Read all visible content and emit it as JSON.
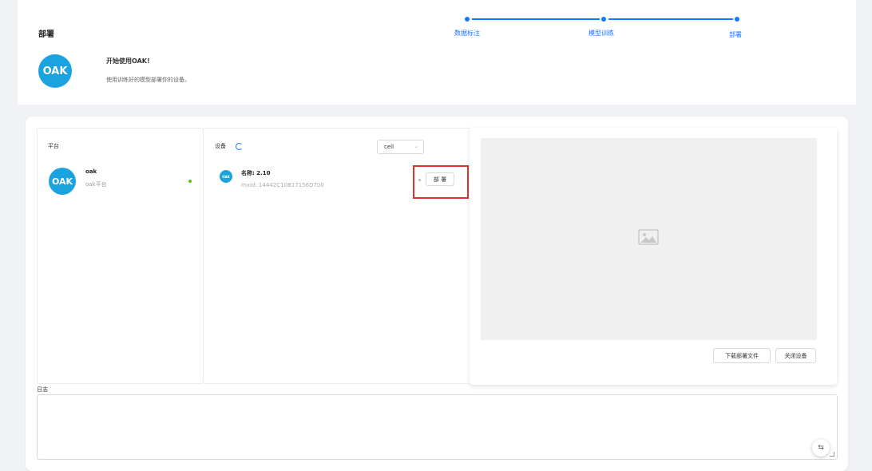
{
  "header": {
    "title": "部署",
    "logo_text": "OAK",
    "intro_title": "开始使用OAK!",
    "intro_desc": "使用训练好的模型部署你的设备。"
  },
  "steps": [
    {
      "label": "数据标注"
    },
    {
      "label": "模型训练"
    },
    {
      "label": "部署"
    }
  ],
  "accent_color": "#1677ff",
  "platform": {
    "title": "平台",
    "logo_text": "OAK",
    "name": "oak",
    "sub": "oak平台",
    "status_color": "#52c41a"
  },
  "device": {
    "title": "设备",
    "select_value": "cell",
    "logo_text": "OAK",
    "name": "名称: 2.10",
    "mxid": "mxid: 14442C10B17156D700",
    "deploy_label": "部 署"
  },
  "preview": {
    "download_label": "下载部署文件",
    "close_label": "关闭设备"
  },
  "log": {
    "label": "日志"
  },
  "icons": {
    "spinner": "loading-icon",
    "image": "image-placeholder-icon",
    "swap": "swap-icon"
  }
}
